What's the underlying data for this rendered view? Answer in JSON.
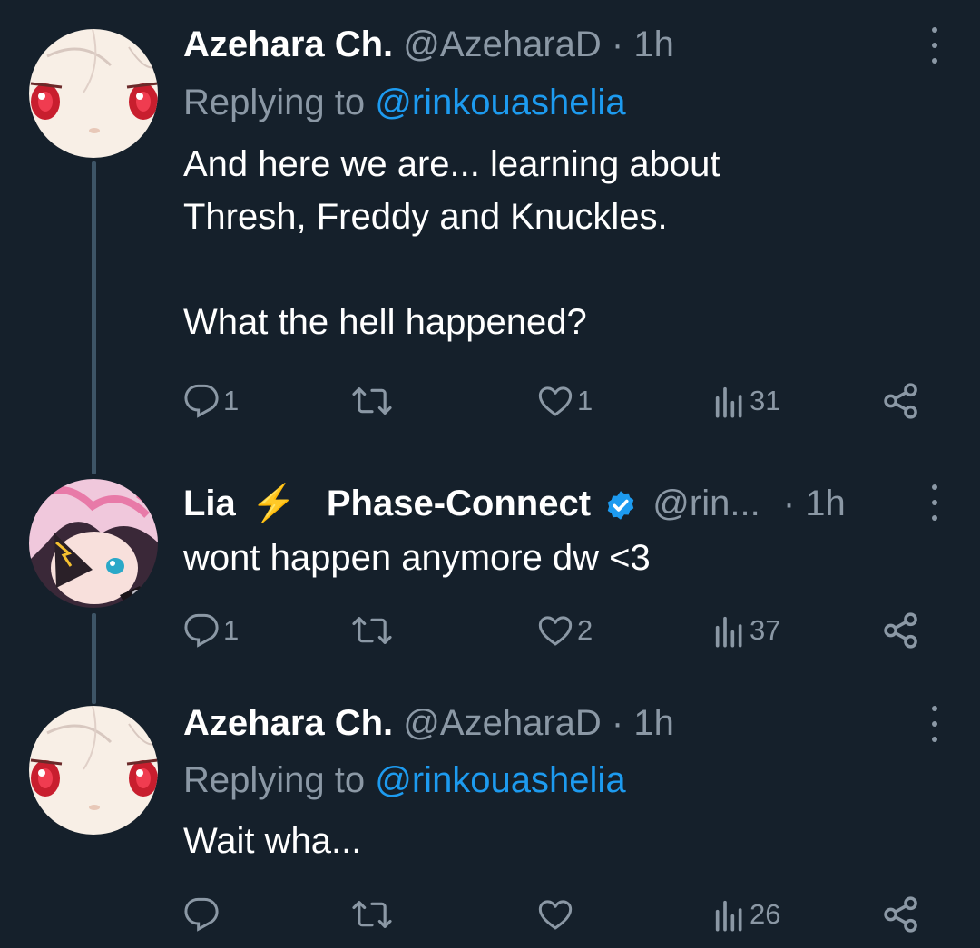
{
  "tweets": [
    {
      "name": "Azehara Ch.",
      "handle": "@AzeharaD",
      "dot": "·",
      "time": "1h",
      "replying_prefix": "Replying to",
      "replying_handle": "@rinkouashelia",
      "text": "And here we are... learning about\nThresh, Freddy and Knuckles.\n\nWhat the hell happened?",
      "replies": "1",
      "retweets": "",
      "likes": "1",
      "views": "31"
    },
    {
      "name": "Lia",
      "emoji": "⚡",
      "org": "Phase-Connect",
      "handle": "@rin...",
      "dot": "·",
      "time": "1h",
      "verified": true,
      "text": "wont happen anymore dw <3",
      "replies": "1",
      "retweets": "",
      "likes": "2",
      "views": "37"
    },
    {
      "name": "Azehara Ch.",
      "handle": "@AzeharaD",
      "dot": "·",
      "time": "1h",
      "replying_prefix": "Replying to",
      "replying_handle": "@rinkouashelia",
      "text": "Wait wha...",
      "replies": "",
      "retweets": "",
      "likes": "",
      "views": "26"
    }
  ],
  "colors": {
    "background": "#15202b",
    "secondary_text": "#8b98a5",
    "link": "#1d9bf0",
    "thread_line": "#3d5466",
    "verified": "#1d9bf0",
    "lightning": "#f5a623"
  },
  "icons": [
    "reply-icon",
    "retweet-icon",
    "like-icon",
    "views-icon",
    "share-icon",
    "more-icon",
    "verified-badge-icon"
  ]
}
